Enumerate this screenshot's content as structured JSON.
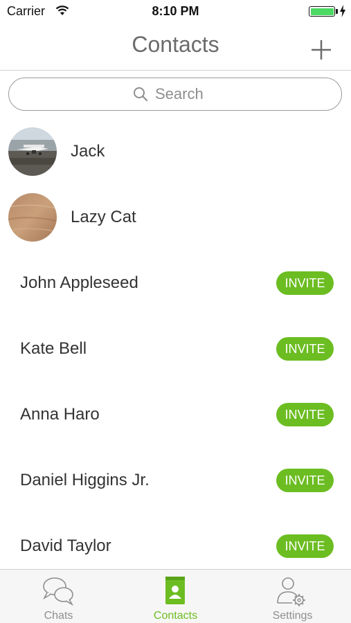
{
  "status_bar": {
    "carrier": "Carrier",
    "time": "8:10 PM",
    "battery_level": 1.0
  },
  "nav": {
    "title": "Contacts",
    "add_icon": "plus-icon"
  },
  "search": {
    "placeholder": "Search",
    "value": "",
    "icon": "search-icon"
  },
  "friends": [
    {
      "name": "Jack",
      "avatar": "airplane-photo"
    },
    {
      "name": "Lazy Cat",
      "avatar": "sand-texture-photo"
    }
  ],
  "contacts": [
    {
      "name": "John Appleseed",
      "action": "INVITE"
    },
    {
      "name": "Kate Bell",
      "action": "INVITE"
    },
    {
      "name": "Anna Haro",
      "action": "INVITE"
    },
    {
      "name": "Daniel Higgins Jr.",
      "action": "INVITE"
    },
    {
      "name": "David Taylor",
      "action": "INVITE"
    }
  ],
  "tabs": [
    {
      "label": "Chats",
      "icon": "chat-bubbles-icon",
      "active": false
    },
    {
      "label": "Contacts",
      "icon": "contact-book-icon",
      "active": true
    },
    {
      "label": "Settings",
      "icon": "user-gear-icon",
      "active": false
    }
  ],
  "colors": {
    "accent": "#6cbd22",
    "battery": "#4cd964",
    "title": "#6b6b6b",
    "inactive_tab": "#8e8e8e"
  }
}
